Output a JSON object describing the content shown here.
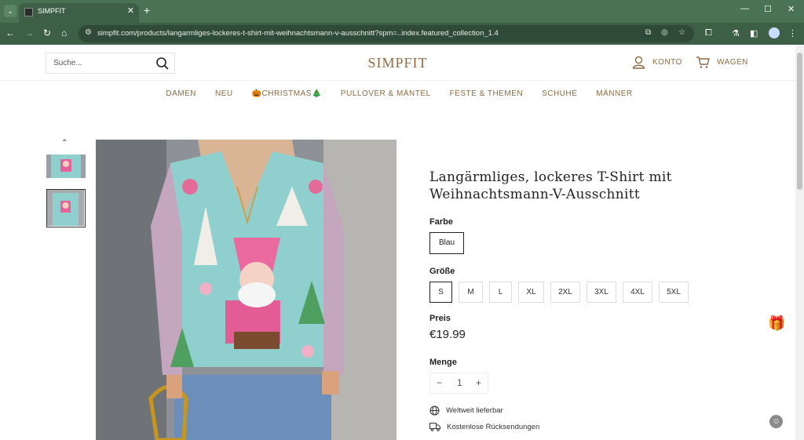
{
  "browser": {
    "tab_title": "SIMPFIT",
    "url": "simpfit.com/products/langarmliges-lockeres-t-shirt-mit-weihnachtsmann-v-ausschnitt?spm=..index.featured_collection_1.4"
  },
  "header": {
    "search_placeholder": "Suche...",
    "logo": "SIMPFIT",
    "account_label": "KONTO",
    "cart_label": "WAGEN"
  },
  "nav": {
    "items": [
      "DAMEN",
      "NEU",
      "🎃CHRISTMAS🎄",
      "PULLOVER & MÄNTEL",
      "FESTE & THEMEN",
      "SCHUHE",
      "MÄNNER"
    ]
  },
  "product": {
    "title": "Langärmliges, lockeres T-Shirt mit Weihnachtsmann-V-Ausschnitt",
    "color_label": "Farbe",
    "color_value": "Blau",
    "size_label": "Größe",
    "sizes": [
      "S",
      "M",
      "L",
      "XL",
      "2XL",
      "3XL",
      "4XL",
      "5XL"
    ],
    "selected_size": "S",
    "price_label": "Preis",
    "price": "€19.99",
    "quantity_label": "Menge",
    "quantity": "1",
    "qty_minus": "−",
    "qty_plus": "+",
    "features": [
      "Weltweit lieferbar",
      "Kostenlose Rücksendungen"
    ]
  },
  "colors": {
    "accent": "#8d6b45",
    "chrome": "#4a7356"
  }
}
